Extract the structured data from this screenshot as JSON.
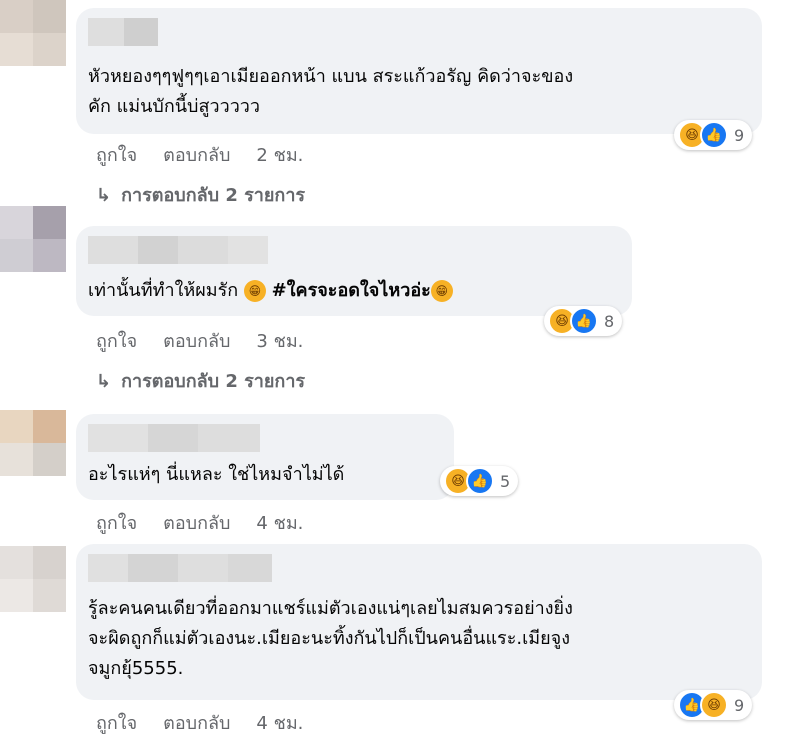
{
  "comments": [
    {
      "text_lines": [
        "หัวหยองๆๆฟูๆๆเอาเมียออกหน้า แบน สระแก้วอรัญ คิดว่าจะของ",
        "คัก แม่นบักนี้บ่สูววววว"
      ],
      "reactions": {
        "icons": [
          "haha",
          "like"
        ],
        "count": "9"
      },
      "like_label": "ถูกใจ",
      "reply_label": "ตอบกลับ",
      "time": "2 ชม.",
      "replies_label": "การตอบกลับ 2 รายการ"
    },
    {
      "text_main": "เท่านั้นที่ทำให้ผมรัก ",
      "hashtag": "#ใครจะอดใจไหวอ่ะ",
      "reactions": {
        "icons": [
          "haha",
          "like"
        ],
        "count": "8"
      },
      "like_label": "ถูกใจ",
      "reply_label": "ตอบกลับ",
      "time": "3 ชม.",
      "replies_label": "การตอบกลับ 2 รายการ"
    },
    {
      "text_lines": [
        "อะไรแห่ๆ นี่แหละ ใช่ไหมจำไม่ได้"
      ],
      "reactions": {
        "icons": [
          "haha",
          "like"
        ],
        "count": "5"
      },
      "like_label": "ถูกใจ",
      "reply_label": "ตอบกลับ",
      "time": "4 ชม."
    },
    {
      "text_lines": [
        "รู้ละคนคนเดียวที่ออกมาแชร์แม่ตัวเองแน่ๆเลยไมสมควรอย่างยิ่ง",
        "จะผิดถูกก็แม่ตัวเองนะ.เมียอะนะทิ้งกันไปก็เป็นคนอื่นแระ.เมียจูง",
        "จมูกยุ้5555."
      ],
      "reactions": {
        "icons": [
          "like",
          "haha"
        ],
        "count": "9"
      },
      "like_label": "ถูกใจ",
      "reply_label": "ตอบกลับ",
      "time": "4 ชม."
    }
  ],
  "colors": {
    "bubble": "#f0f2f5",
    "meta": "#65676b",
    "like": "#1877f2",
    "haha": "#f7b125"
  }
}
